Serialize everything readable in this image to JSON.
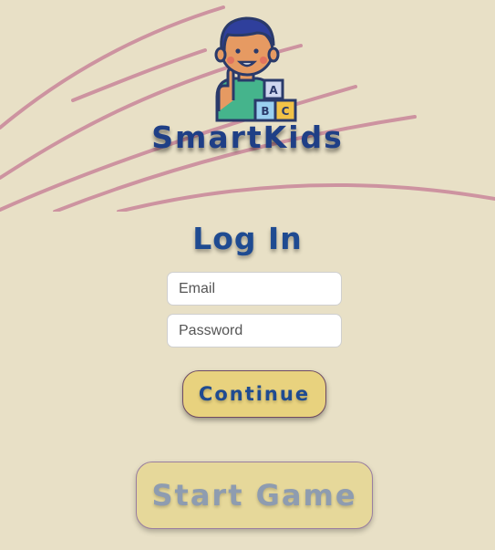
{
  "app": {
    "brand_name": "SmartKids"
  },
  "login": {
    "title": "Log In",
    "email_placeholder": "Email",
    "password_placeholder": "Password",
    "continue_label": "Continue"
  },
  "game": {
    "start_label": "Start Game"
  },
  "icons": {
    "logo": "kid-with-abc-blocks-icon"
  },
  "colors": {
    "background": "#e8e0c6",
    "brand_blue": "#1f3f86",
    "button_yellow": "#e8d27e",
    "swirl_pink": "#c9869a"
  }
}
